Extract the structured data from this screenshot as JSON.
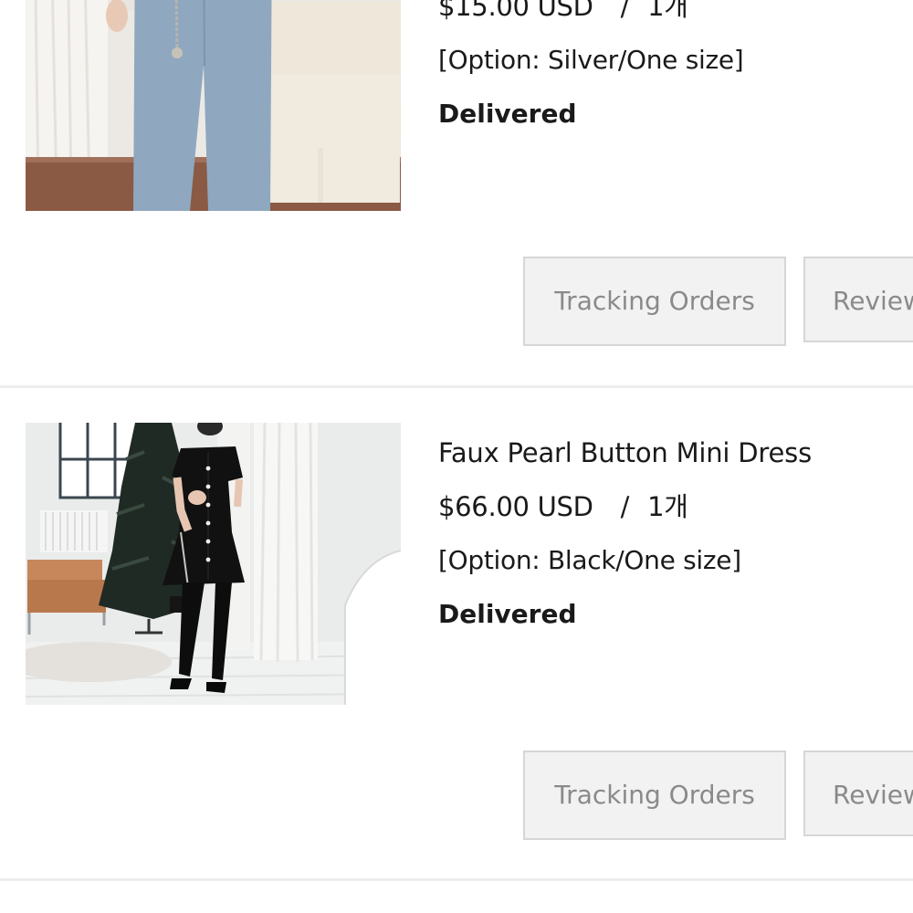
{
  "orders": [
    {
      "name": "",
      "price": "$15.00 USD",
      "separator": "/",
      "quantity": "1개",
      "option": "[Option: Silver/One size]",
      "status": "Delivered",
      "image": "chain-belt-product-photo",
      "buttons": {
        "tracking": "Tracking Orders",
        "review": "Review"
      }
    },
    {
      "name": "Faux Pearl Button Mini Dress",
      "price": "$66.00 USD",
      "separator": "/",
      "quantity": "1개",
      "option": "[Option: Black/One size]",
      "status": "Delivered",
      "image": "black-mini-dress-product-photo",
      "buttons": {
        "tracking": "Tracking Orders",
        "review": "Review"
      }
    }
  ]
}
